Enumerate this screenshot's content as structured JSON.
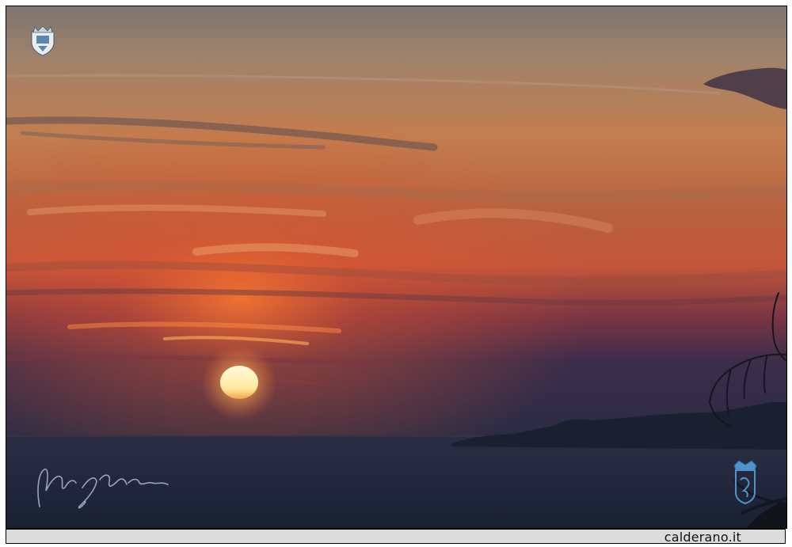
{
  "caption": {
    "site": "calderano.it"
  },
  "logos": {
    "top_left": "coat-of-arms-logo",
    "bottom_right": "crest-logo",
    "signature": "handwritten-signature"
  },
  "colors": {
    "sky_top": "#8a7d74",
    "sky_mid": "#c9804e",
    "sky_glow": "#e06a35",
    "horizon": "#3b2a4a",
    "sea": "#1e2537",
    "sun": "#fff4c8",
    "land": "#1b2030",
    "caption_bar": "#dcdcdc"
  }
}
